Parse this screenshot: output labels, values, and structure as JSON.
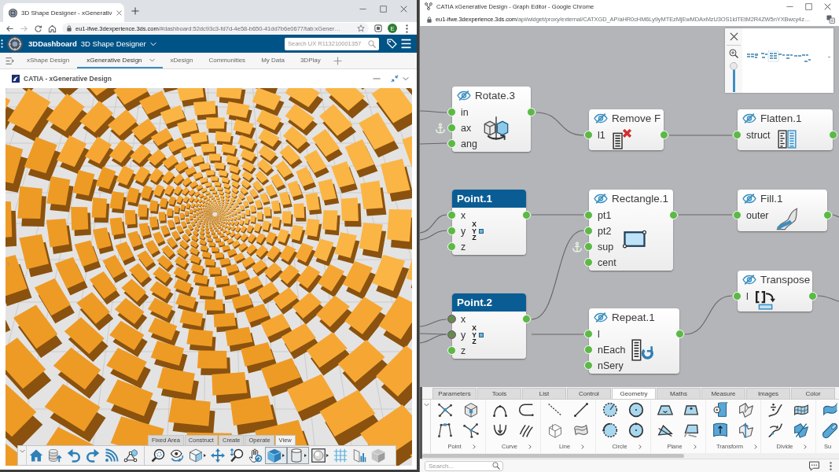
{
  "left_window": {
    "browser_tab": {
      "title": "3D Shape Designer - xGenerativ"
    },
    "address_bar": {
      "host": "eu1-ifwe.3dexperience.3ds.com",
      "path": "/#dashboard:52dc93c3-fd7d-4e58-b650-41dd7b6e0677/tab:xGener…",
      "profile_initial": "E"
    },
    "dashboard_header": {
      "brand": "3DDashboard",
      "app_name": "3D Shape Designer",
      "search": {
        "placeholder": "Search UX R113210001357"
      }
    },
    "tabs": [
      {
        "label": "xShape Design",
        "selected": false
      },
      {
        "label": "xGenerative Design",
        "selected": true
      },
      {
        "label": "xDesign",
        "selected": false
      },
      {
        "label": "Communities",
        "selected": false
      },
      {
        "label": "My Data",
        "selected": false
      },
      {
        "label": "3DPlay",
        "selected": false
      }
    ],
    "widget": {
      "title": "CATIA - xGenerative Design",
      "viewport": {
        "toolbar_tabs": [
          {
            "label": "Fixed Area",
            "selected": false
          },
          {
            "label": "Construct",
            "selected": false
          },
          {
            "label": "Create",
            "selected": false
          },
          {
            "label": "Operate",
            "selected": false
          },
          {
            "label": "View",
            "selected": true
          }
        ],
        "tools": [
          {
            "selected": false,
            "dropdown": false
          },
          {
            "selected": false,
            "dropdown": false
          },
          {
            "selected": false,
            "dropdown": false
          },
          {
            "selected": false,
            "dropdown": false
          },
          {
            "selected": false,
            "dropdown": false
          },
          {
            "selected": false,
            "dropdown": false
          },
          {
            "selected": false,
            "dropdown": false
          },
          {
            "selected": false,
            "dropdown": false
          },
          {
            "selected": false,
            "dropdown": true
          },
          {
            "selected": false,
            "dropdown": false
          },
          {
            "selected": false,
            "dropdown": false
          },
          {
            "selected": false,
            "dropdown": false
          },
          {
            "selected": true,
            "dropdown": true
          },
          {
            "selected": true,
            "dropdown": true
          },
          {
            "selected": false,
            "dropdown": true
          },
          {
            "selected": false,
            "dropdown": false
          },
          {
            "selected": false,
            "dropdown": false
          },
          {
            "selected": false,
            "dropdown": false
          }
        ]
      }
    }
  },
  "right_window": {
    "title": "CATIA xGenerative Design - Graph Editor - Google Chrome",
    "address_bar": {
      "host": "eu1-ifwe.3dexperience.3ds.com",
      "path": "/api/widget/proxy/external/CATXGD_AP/aHR0cHM6Ly9yMTEzMjEwMDAxMzU3OS1ldTEtM2R4ZW5nYXBwcy4z…"
    },
    "graph": {
      "nodes": [
        {
          "title": "Rotate.3",
          "selected": false,
          "hidden": true,
          "inputs": [
            {
              "name": "in",
              "kind": "plain"
            },
            {
              "name": "ax",
              "kind": "anchored"
            },
            {
              "name": "ang",
              "kind": "plain"
            }
          ]
        },
        {
          "title": "Remove F",
          "selected": false,
          "hidden": true,
          "inputs": [
            {
              "name": "l1",
              "kind": "plain"
            }
          ]
        },
        {
          "title": "Flatten.1",
          "selected": false,
          "hidden": true,
          "inputs": [
            {
              "name": "struct",
              "kind": "plain"
            }
          ]
        },
        {
          "title": "Point.1",
          "selected": true,
          "hidden": false,
          "inputs": [
            {
              "name": "x",
              "kind": "plain"
            },
            {
              "name": "y",
              "kind": "plain"
            },
            {
              "name": "z",
              "kind": "plain"
            }
          ],
          "axis_letters": [
            "X",
            "Y",
            "Z"
          ]
        },
        {
          "title": "Rectangle.1",
          "selected": false,
          "hidden": true,
          "inputs": [
            {
              "name": "pt1",
              "kind": "plain"
            },
            {
              "name": "pt2",
              "kind": "plain"
            },
            {
              "name": "sup",
              "kind": "anchored"
            },
            {
              "name": "cent",
              "kind": "plain"
            }
          ]
        },
        {
          "title": "Fill.1",
          "selected": false,
          "hidden": true,
          "inputs": [
            {
              "name": "outer",
              "kind": "plain"
            }
          ]
        },
        {
          "title": "Transpose",
          "selected": false,
          "hidden": true,
          "inputs": [
            {
              "name": "l",
              "kind": "plain"
            }
          ]
        },
        {
          "title": "Point.2",
          "selected": true,
          "hidden": false,
          "inputs": [
            {
              "name": "x",
              "kind": "highlighted"
            },
            {
              "name": "y",
              "kind": "highlighted"
            },
            {
              "name": "z",
              "kind": "plain"
            }
          ],
          "axis_letters": [
            "X",
            "Y",
            "Z"
          ]
        },
        {
          "title": "Repeat.1",
          "selected": false,
          "hidden": true,
          "inputs": [
            {
              "name": "l",
              "kind": "plain"
            },
            {
              "name": "nEach",
              "kind": "plain"
            },
            {
              "name": "nSery",
              "kind": "plain"
            }
          ]
        }
      ],
      "minimap": {
        "zoom": {
          "level": 0.95
        }
      }
    },
    "palette": {
      "tabs": [
        {
          "label": "Parameters",
          "selected": false
        },
        {
          "label": "Tools",
          "selected": false
        },
        {
          "label": "List",
          "selected": false
        },
        {
          "label": "Control",
          "selected": false
        },
        {
          "label": "Geometry",
          "selected": true
        },
        {
          "label": "Maths",
          "selected": false
        },
        {
          "label": "Measure",
          "selected": false
        },
        {
          "label": "Images",
          "selected": false
        },
        {
          "label": "Color",
          "selected": false
        }
      ],
      "groups": [
        {
          "label": "Point",
          "expand_arrow": true
        },
        {
          "label": "Curve",
          "expand_arrow": true
        },
        {
          "label": "Line",
          "expand_arrow": true
        },
        {
          "label": "Circle",
          "expand_arrow": true
        },
        {
          "label": "Plane",
          "expand_arrow": true
        },
        {
          "label": "Transform",
          "expand_arrow": true
        },
        {
          "label": "Divide",
          "expand_arrow": true
        },
        {
          "label": "Su",
          "expand_arrow": false
        }
      ]
    },
    "status_bar": {
      "search": {
        "placeholder": "Search..."
      }
    }
  }
}
